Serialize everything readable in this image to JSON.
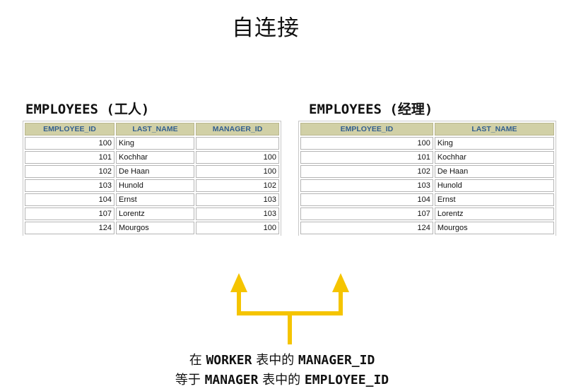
{
  "title": "自连接",
  "worker_table": {
    "heading": "EMPLOYEES (工人)",
    "columns": [
      "EMPLOYEE_ID",
      "LAST_NAME",
      "MANAGER_ID"
    ],
    "rows": [
      [
        "100",
        "King",
        ""
      ],
      [
        "101",
        "Kochhar",
        "100"
      ],
      [
        "102",
        "De Haan",
        "100"
      ],
      [
        "103",
        "Hunold",
        "102"
      ],
      [
        "104",
        "Ernst",
        "103"
      ],
      [
        "107",
        "Lorentz",
        "103"
      ],
      [
        "124",
        "Mourgos",
        "100"
      ]
    ]
  },
  "manager_table": {
    "heading": "EMPLOYEES (经理)",
    "columns": [
      "EMPLOYEE_ID",
      "LAST_NAME"
    ],
    "rows": [
      [
        "100",
        "King"
      ],
      [
        "101",
        "Kochhar"
      ],
      [
        "102",
        "De Haan"
      ],
      [
        "103",
        "Hunold"
      ],
      [
        "104",
        "Ernst"
      ],
      [
        "107",
        "Lorentz"
      ],
      [
        "124",
        "Mourgos"
      ]
    ]
  },
  "caption": {
    "line1": {
      "prefix": "在 ",
      "table": "WORKER",
      "middle": " 表中的 ",
      "column": "MANAGER_ID"
    },
    "line2": {
      "prefix": "等于 ",
      "table": "MANAGER",
      "middle": " 表中的 ",
      "column": "EMPLOYEE_ID"
    }
  },
  "colors": {
    "arrow": "#f5c400",
    "header_bg": "#d1d0a6",
    "header_text": "#335f8e"
  }
}
